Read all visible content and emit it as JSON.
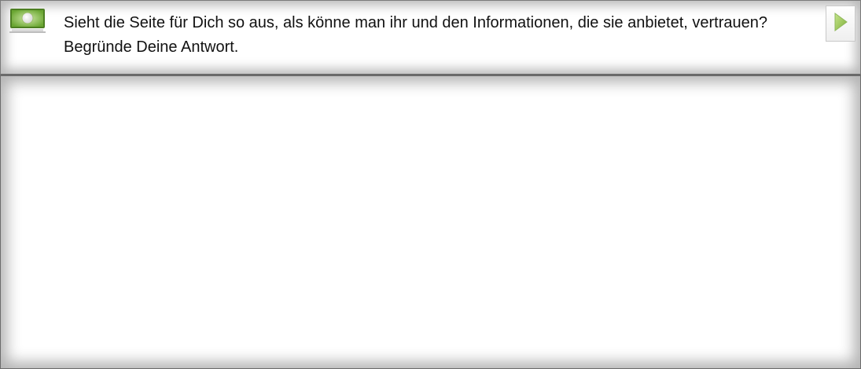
{
  "question": {
    "text": "Sieht die Seite für Dich so aus, als könne man ihr und den Informationen, die sie anbietet, vertrauen? Begründe Deine Antwort.",
    "icon": "monitor-globe-icon",
    "next_icon": "play-arrow-icon"
  },
  "answer": {
    "value": "",
    "placeholder": ""
  },
  "colors": {
    "accent_green": "#8cc63f",
    "border_gray": "#6c6c6c"
  }
}
